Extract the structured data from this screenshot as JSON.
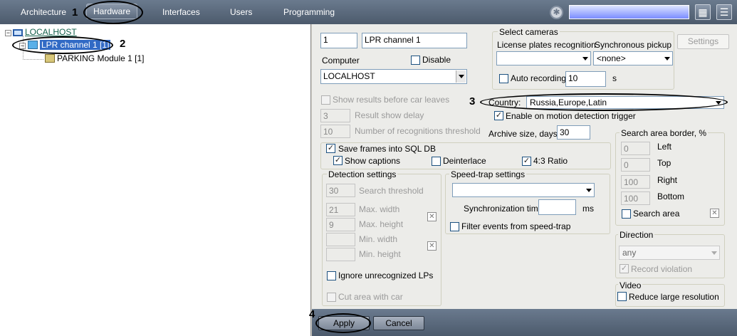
{
  "topnav": {
    "tabs": [
      "Architecture",
      "Hardware",
      "Interfaces",
      "Users",
      "Programming"
    ],
    "active": "Hardware",
    "search_value": ""
  },
  "annotations": [
    "1",
    "2",
    "3",
    "4"
  ],
  "tree": {
    "root": "LOCALHOST",
    "channel": "LPR channel 1 [1]",
    "module": "PARKING Module 1 [1]"
  },
  "form": {
    "id": "1",
    "name": "LPR channel 1",
    "computer_label": "Computer",
    "disable_label": "Disable",
    "computer_value": "LOCALHOST",
    "select_cameras": {
      "title": "Select cameras",
      "lpr_label": "License plates recognition",
      "sync_label": "Synchronous pickup",
      "lpr_value": "",
      "sync_value": "<none>",
      "auto_recording_label": "Auto recording",
      "auto_recording_value": "10",
      "unit": "s"
    },
    "settings_button": "Settings",
    "show_results_label": "Show results before car leaves",
    "result_delay_value": "3",
    "result_delay_label": "Result show delay",
    "recog_threshold_value": "10",
    "recog_threshold_label": "Number of recognitions threshold",
    "country_label": "Country:",
    "country_value": "Russia,Europe,Latin",
    "motion_trigger_label": "Enable on motion detection trigger",
    "archive_label": "Archive size, days:",
    "archive_value": "30",
    "save_frames_label": "Save frames into SQL DB",
    "show_captions_label": "Show captions",
    "deinterlace_label": "Deinterlace",
    "ratio_label": "4:3 Ratio",
    "detection": {
      "title": "Detection settings",
      "search_threshold_value": "30",
      "search_threshold_label": "Search threshold",
      "max_width_value": "21",
      "max_width_label": "Max. width",
      "max_height_value": "9",
      "max_height_label": "Max. height",
      "min_width_value": "",
      "min_width_label": "Min. width",
      "min_height_value": "",
      "min_height_label": "Min. height",
      "ignore_label": "Ignore unrecognized LPs",
      "cut_area_label": "Cut area with car"
    },
    "speed_trap": {
      "title": "Speed-trap settings",
      "select_value": "",
      "sync_time_label": "Synchronization time",
      "sync_time_value": "",
      "unit": "ms",
      "filter_label": "Filter events from speed-trap"
    },
    "search_area": {
      "title": "Search area border, %",
      "left_value": "0",
      "left_label": "Left",
      "top_value": "0",
      "top_label": "Top",
      "right_value": "100",
      "right_label": "Right",
      "bottom_value": "100",
      "bottom_label": "Bottom",
      "search_area_label": "Search area"
    },
    "direction": {
      "title": "Direction",
      "value": "any",
      "record_violation_label": "Record violation"
    },
    "video": {
      "title": "Video",
      "reduce_label": "Reduce large resolution"
    }
  },
  "footer": {
    "apply": "Apply",
    "cancel": "Cancel"
  }
}
